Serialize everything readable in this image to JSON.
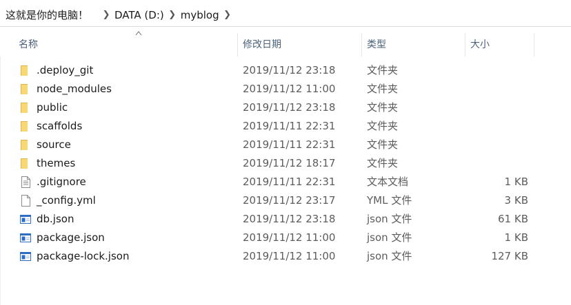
{
  "address": {
    "root": "！这就是你的电脑！",
    "drive": "DATA (D:)",
    "folder": "myblog"
  },
  "columns": {
    "name": "名称",
    "date": "修改日期",
    "type": "类型",
    "size": "大小",
    "sorted_by": "name"
  },
  "files": [
    {
      "name": ".deploy_git",
      "date": "2019/11/12 23:18",
      "type": "文件夹",
      "size": "",
      "icon": "folder-icon"
    },
    {
      "name": "node_modules",
      "date": "2019/11/12 11:00",
      "type": "文件夹",
      "size": "",
      "icon": "folder-icon"
    },
    {
      "name": "public",
      "date": "2019/11/12 23:18",
      "type": "文件夹",
      "size": "",
      "icon": "folder-icon"
    },
    {
      "name": "scaffolds",
      "date": "2019/11/11 22:31",
      "type": "文件夹",
      "size": "",
      "icon": "folder-icon"
    },
    {
      "name": "source",
      "date": "2019/11/11 22:31",
      "type": "文件夹",
      "size": "",
      "icon": "folder-icon"
    },
    {
      "name": "themes",
      "date": "2019/11/12 18:17",
      "type": "文件夹",
      "size": "",
      "icon": "folder-icon"
    },
    {
      "name": ".gitignore",
      "date": "2019/11/11 22:31",
      "type": "文本文档",
      "size": "1 KB",
      "icon": "text-file-icon"
    },
    {
      "name": "_config.yml",
      "date": "2019/11/12 23:17",
      "type": "YML 文件",
      "size": "3 KB",
      "icon": "blank-file-icon"
    },
    {
      "name": "db.json",
      "date": "2019/11/12 23:18",
      "type": "json 文件",
      "size": "61 KB",
      "icon": "json-file-icon"
    },
    {
      "name": "package.json",
      "date": "2019/11/12 11:00",
      "type": "json 文件",
      "size": "1 KB",
      "icon": "json-file-icon"
    },
    {
      "name": "package-lock.json",
      "date": "2019/11/12 11:00",
      "type": "json 文件",
      "size": "127 KB",
      "icon": "json-file-icon"
    }
  ],
  "colors": {
    "folder": "#f8d775",
    "folder_dark": "#e0b44a",
    "header_text": "#4c607a",
    "json_blue": "#2b6cc4"
  }
}
